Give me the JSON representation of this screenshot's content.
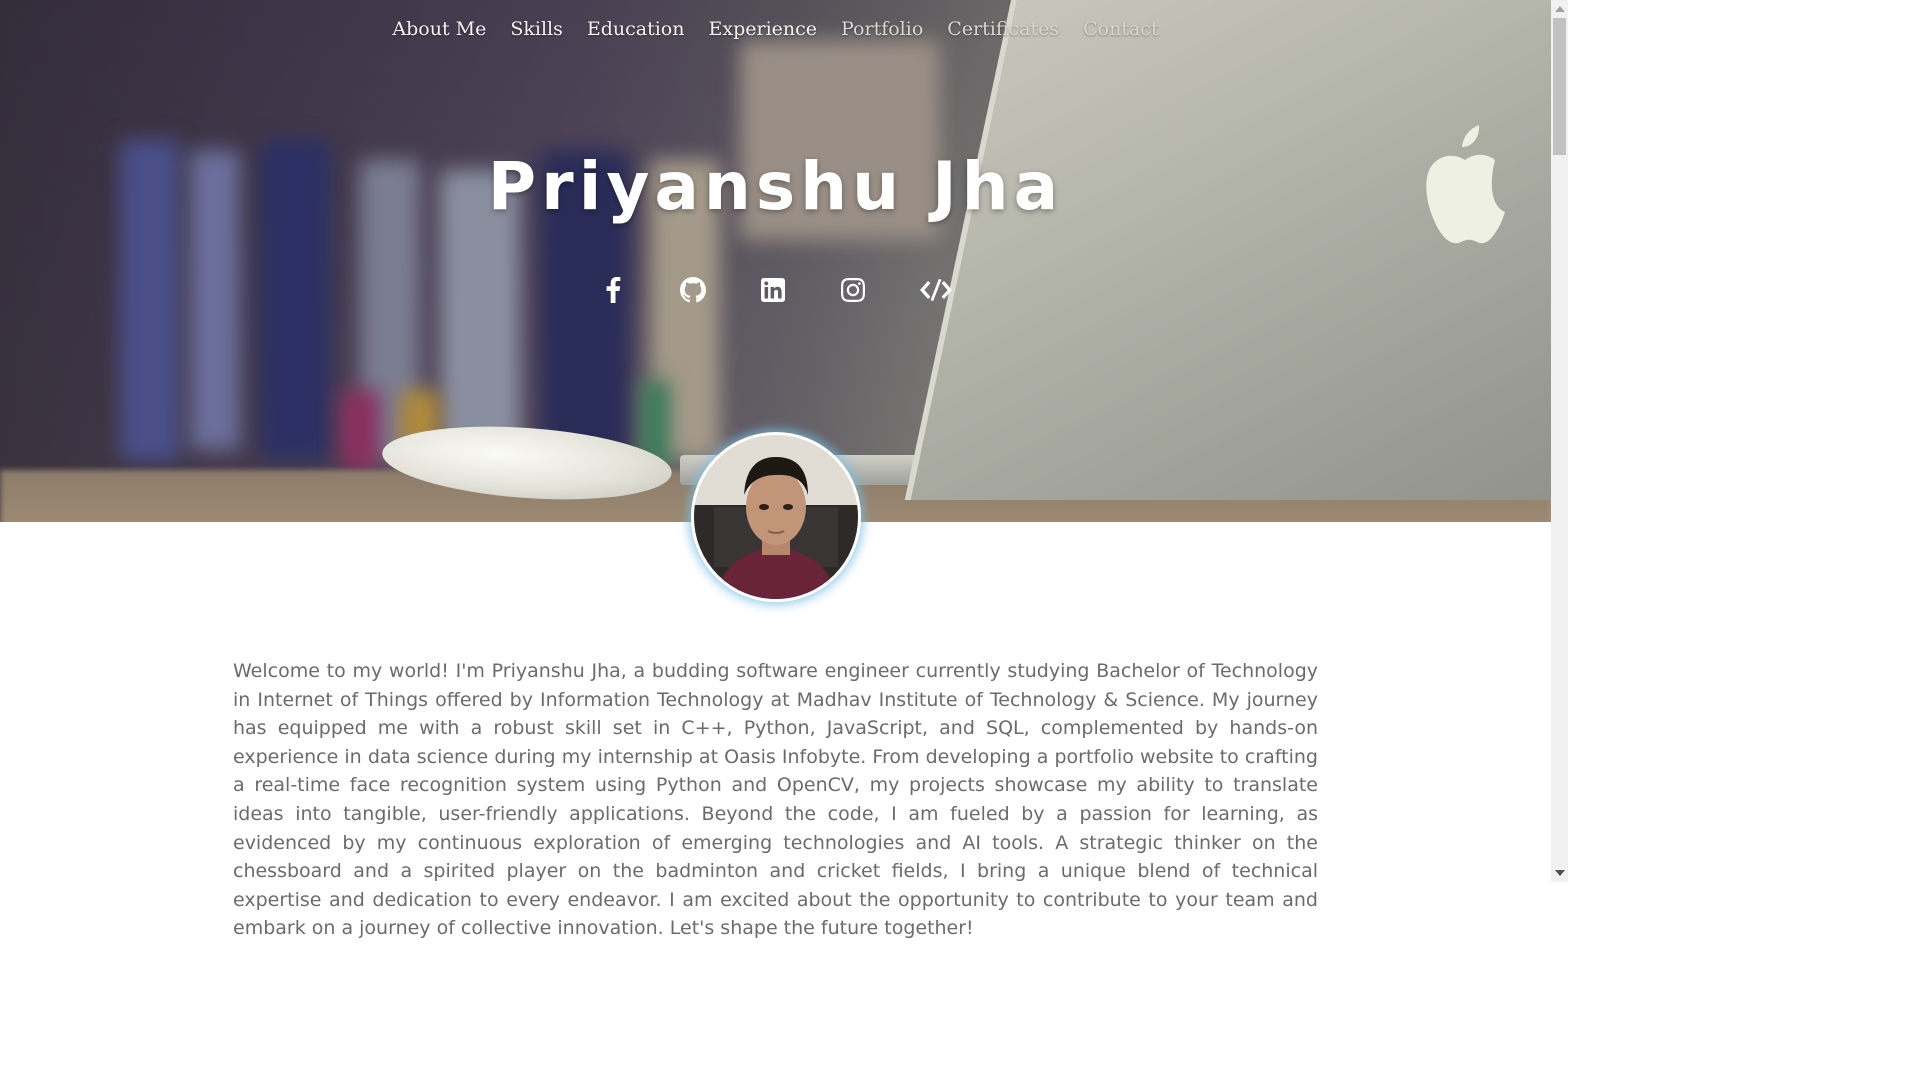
{
  "nav": {
    "items": [
      {
        "label": "About Me"
      },
      {
        "label": "Skills"
      },
      {
        "label": "Education"
      },
      {
        "label": "Experience"
      },
      {
        "label": "Portfolio"
      },
      {
        "label": "Certificates"
      },
      {
        "label": "Contact"
      }
    ]
  },
  "hero": {
    "name": "Priyanshu Jha",
    "social": [
      {
        "icon": "facebook-icon"
      },
      {
        "icon": "github-icon"
      },
      {
        "icon": "linkedin-icon"
      },
      {
        "icon": "instagram-icon"
      },
      {
        "icon": "code-icon"
      }
    ]
  },
  "about": {
    "text": "Welcome to my world! I'm Priyanshu Jha, a budding software engineer currently studying Bachelor of Technology in Internet of Things offered by Information Technology at Madhav Institute of Technology & Science. My journey has equipped me with a robust skill set in C++, Python, JavaScript, and SQL, complemented by hands-on experience in data science during my internship at Oasis Infobyte. From developing a portfolio website to crafting a real-time face recognition system using Python and OpenCV, my projects showcase my ability to translate ideas into tangible, user-friendly applications. Beyond the code, I am fueled by a passion for learning, as evidenced by my continuous exploration of emerging technologies and AI tools. A strategic thinker on the chessboard and a spirited player on the badminton and cricket fields, I bring a unique blend of technical expertise and dedication to every endeavor. I am excited about the opportunity to contribute to your team and embark on a journey of collective innovation. Let's shape the future together!"
  },
  "colors": {
    "text_body": "#6b6b6b",
    "avatar_glow": "#78bee6",
    "nav_text": "#f4f1ee"
  }
}
